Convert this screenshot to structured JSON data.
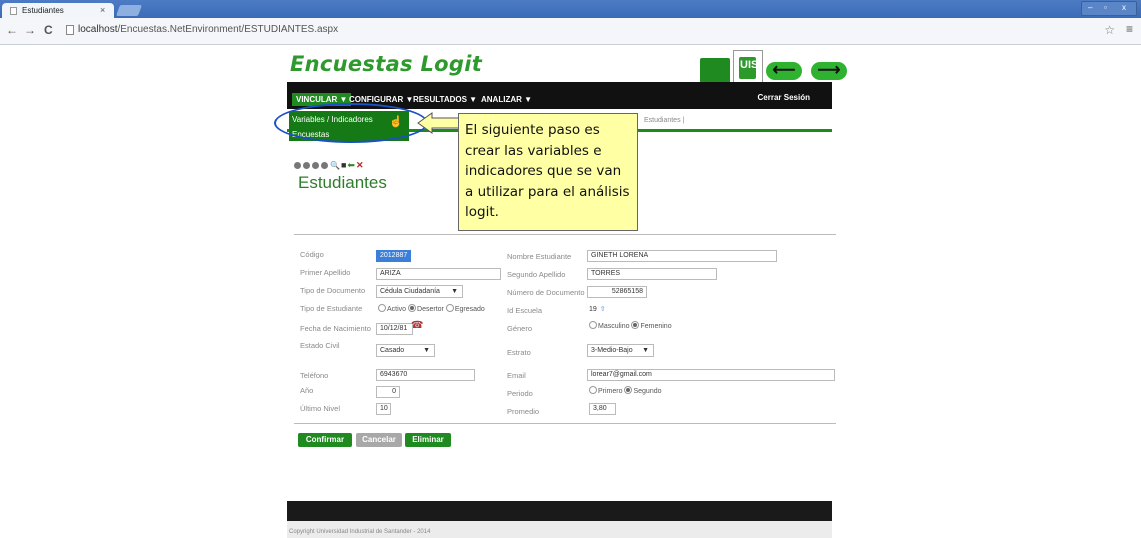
{
  "browser": {
    "tab_title": "Estudiantes",
    "tab_close": "×",
    "back": "←",
    "forward": "→",
    "reload": "C",
    "url_host": "localhost",
    "url_path": "/Encuestas.NetEnvironment/ESTUDIANTES.aspx",
    "star": "☆",
    "menu": "≡"
  },
  "site": {
    "logo": "Encuestas Logit",
    "nav": {
      "item1": "VINCULAR ▼",
      "item2": "CONFIGURAR ▼",
      "item3": "RESULTADOS ▼",
      "item4": "ANALIZAR ▼",
      "logout": "Cerrar Sesión"
    },
    "dropdown": [
      "Variables / Indicadores",
      "Encuestas"
    ],
    "breadcrumb": "Estudiantes  |",
    "callout": "El siguiente paso es crear las variables e indicadores que se van a utilizar para el análisis logit.",
    "page_title": "Estudiantes"
  },
  "form": {
    "codigo_label": "Código",
    "codigo": "2012887",
    "nombre_label": "Nombre Estudiante",
    "nombre": "GINETH LORENA",
    "apellido1_label": "Primer Apellido",
    "apellido1": "ARIZA",
    "apellido2_label": "Segundo Apellido",
    "apellido2": "TORRES",
    "tipo_doc_label": "Tipo de Documento",
    "tipo_doc": "Cédula Ciudadanía",
    "num_doc_label": "Número de Documento",
    "num_doc": "52865158",
    "tipo_est_label": "Tipo de Estudiante",
    "tipo_est_options": [
      "Activo",
      "Desertor",
      "Egresado"
    ],
    "tipo_est_selected": "Desertor",
    "escuela_label": "Id Escuela",
    "escuela": "19",
    "fecha_label": "Fecha de Nacimiento",
    "fecha": "10/12/81",
    "genero_label": "Género",
    "genero_options": [
      "Masculino",
      "Femenino"
    ],
    "genero_selected": "Femenino",
    "civil_label": "Estado Civil",
    "civil": "Casado",
    "estrato_label": "Estrato",
    "estrato": "3-Medio-Bajo",
    "telefono_label": "Teléfono",
    "telefono": "6943670",
    "email_label": "Email",
    "email": "lorear7@gmail.com",
    "anio_label": "Año",
    "anio": "0",
    "periodo_label": "Periodo",
    "periodo_options": [
      "Primero",
      "Segundo"
    ],
    "periodo_selected": "Segundo",
    "nivel_label": "Último Nivel",
    "nivel": "10",
    "promedio_label": "Promedio",
    "promedio": "3,80"
  },
  "buttons": {
    "confirm": "Confirmar",
    "cancel": "Cancelar",
    "delete": "Eliminar"
  },
  "footer": {
    "copyright": "Copyright Universidad Industrial de Santander - 2014"
  },
  "colors": {
    "brand_green": "#1f8a1f",
    "callout_bg": "#ffffa3",
    "highlight_ellipse": "#1b4fc6"
  }
}
